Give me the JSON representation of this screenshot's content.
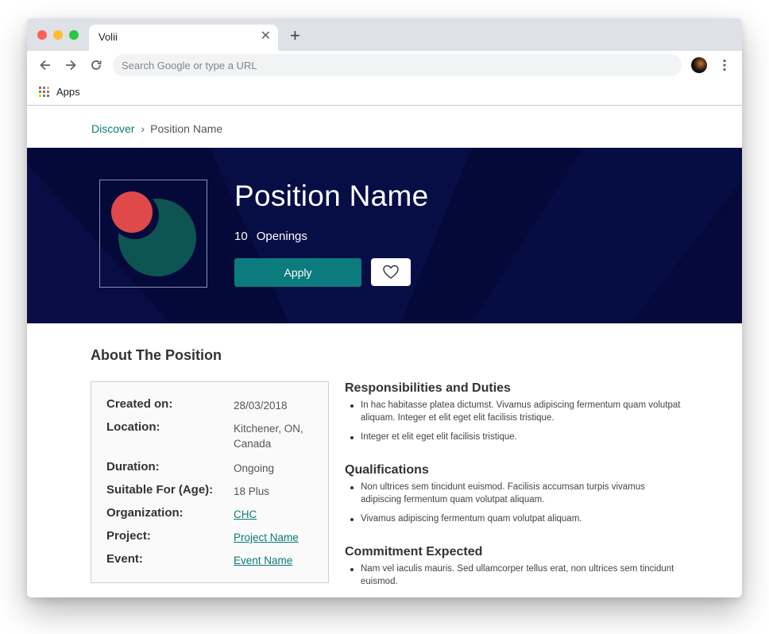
{
  "browser": {
    "tab_title": "Volii",
    "tab_close": "✕",
    "new_tab": "+",
    "omnibox_placeholder": "Search Google or type a URL",
    "bookmarks": {
      "apps_label": "Apps"
    },
    "icons": [
      "back-icon",
      "forward-icon",
      "reload-icon",
      "profile-avatar",
      "more-vert-icon",
      "apps-grid-icon",
      "close-icon",
      "plus-icon"
    ]
  },
  "breadcrumb": {
    "link": "Discover",
    "separator": "›",
    "current": "Position Name"
  },
  "hero": {
    "title": "Position Name",
    "openings_count": "10",
    "openings_label": "Openings",
    "apply_label": "Apply",
    "background_color": "#04093a",
    "accent_color": "#0b7b7d",
    "logo_colors": {
      "circle_red": "#e0494a",
      "circle_green": "#0d5452"
    }
  },
  "about": {
    "title": "About The Position",
    "details": [
      {
        "label": "Created on:",
        "value": "28/03/2018",
        "link": false
      },
      {
        "label": "Location:",
        "value": "Kitchener, ON, Canada",
        "link": false
      },
      {
        "label": "Duration:",
        "value": "Ongoing",
        "link": false
      },
      {
        "label": "Suitable For (Age):",
        "value": "18 Plus",
        "link": false
      },
      {
        "label": "Organization:",
        "value": "CHC",
        "link": true
      },
      {
        "label": "Project:",
        "value": "Project Name",
        "link": true
      },
      {
        "label": "Event:",
        "value": "Event Name",
        "link": true
      }
    ],
    "sections": [
      {
        "title": "Responsibilities and Duties",
        "items": [
          "In hac habitasse platea dictumst. Vivamus adipiscing fermentum quam volutpat aliquam. Integer et elit eget elit facilisis tristique.",
          "Integer et elit eget elit facilisis tristique."
        ]
      },
      {
        "title": "Qualifications",
        "items": [
          "Non ultrices sem tincidunt euismod. Facilisis accumsan turpis vivamus adipiscing fermentum quam volutpat aliquam.",
          "Vivamus adipiscing fermentum quam volutpat aliquam."
        ]
      },
      {
        "title": "Commitment Expected",
        "items": [
          "Nam vel iaculis mauris. Sed ullamcorper tellus erat, non ultrices sem tincidunt euismod."
        ]
      }
    ]
  }
}
